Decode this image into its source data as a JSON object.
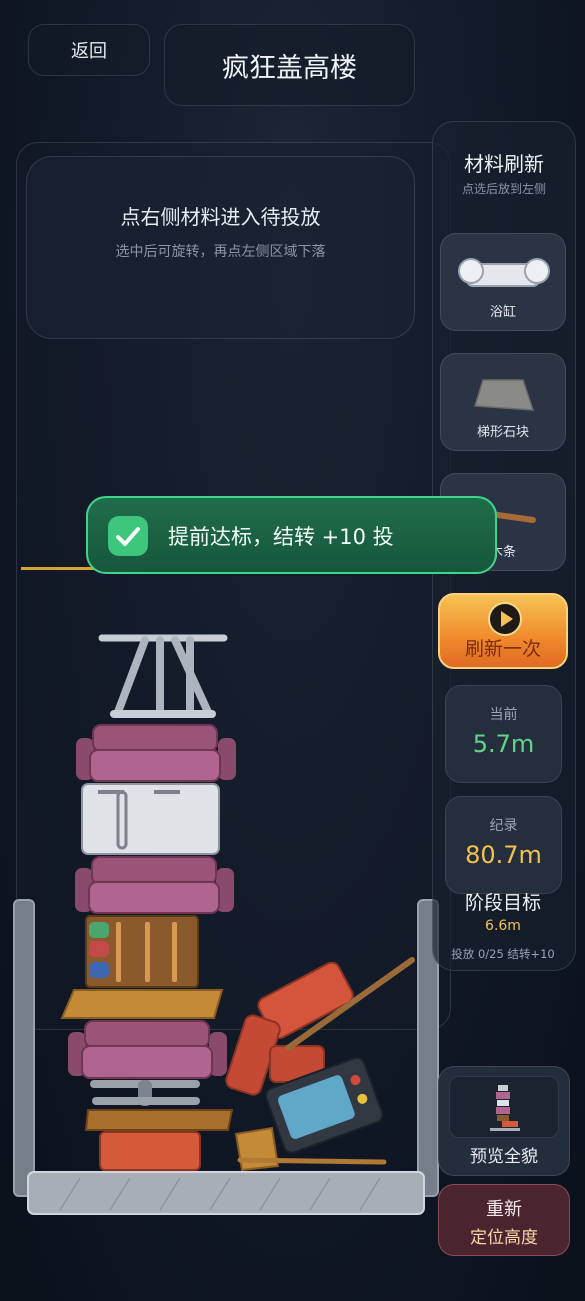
{
  "header": {
    "back_label": "返回",
    "title": "疯狂盖高楼"
  },
  "hint": {
    "title": "点右侧材料进入待投放",
    "subtitle": "选中后可旋转，再点左侧区域下落"
  },
  "side": {
    "title": "材料刷新",
    "subtitle": "点选后放到左侧",
    "materials": [
      {
        "label": "浴缸",
        "icon": "bathtub-icon"
      },
      {
        "label": "梯形石块",
        "icon": "trapezoid-stone-icon"
      },
      {
        "label": "木条",
        "icon": "wood-plank-icon"
      }
    ],
    "refresh_label": "刷新一次"
  },
  "stats": {
    "current_label": "当前",
    "current_value": "5.7m",
    "record_label": "纪录",
    "record_value": "80.7m"
  },
  "goal": {
    "title": "阶段目标",
    "value": "6.6m",
    "info": "投放 0/25 结转+10"
  },
  "toast": {
    "text": "提前达标，结转 +10 投"
  },
  "buttons": {
    "preview_label": "预览全貌",
    "relocate_line1": "重新",
    "relocate_line2": "定位高度"
  },
  "colors": {
    "current_value": "#5fd68c",
    "record_value": "#f3c24a",
    "goal_line": "#d9a532",
    "toast_border": "#3fd48a",
    "refresh_gradient_top": "#f6c255"
  }
}
